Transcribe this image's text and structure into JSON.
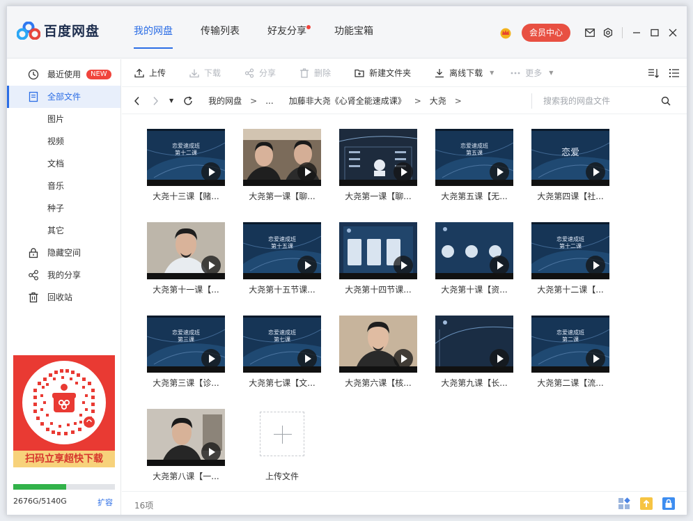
{
  "app": {
    "name": "百度网盘"
  },
  "nav": {
    "tabs": [
      "我的网盘",
      "传输列表",
      "好友分享",
      "功能宝箱"
    ]
  },
  "header": {
    "vip_label": "会员中心"
  },
  "sidebar": {
    "items": [
      {
        "label": "最近使用",
        "badge": "NEW"
      },
      {
        "label": "全部文件"
      },
      {
        "label": "图片"
      },
      {
        "label": "视频"
      },
      {
        "label": "文档"
      },
      {
        "label": "音乐"
      },
      {
        "label": "种子"
      },
      {
        "label": "其它"
      },
      {
        "label": "隐藏空间"
      },
      {
        "label": "我的分享"
      },
      {
        "label": "回收站"
      }
    ],
    "promo_text": "扫码立享超快下载",
    "quota": {
      "text": "2676G/5140G",
      "used_fraction": 0.52,
      "expand_label": "扩容"
    }
  },
  "toolbar": {
    "upload": "上传",
    "download": "下载",
    "share": "分享",
    "delete": "删除",
    "new_folder": "新建文件夹",
    "offline": "离线下载",
    "more": "更多"
  },
  "breadcrumb": {
    "items": [
      "我的网盘",
      "...",
      "加藤非大尧《心肾全能速成课》",
      "大尧"
    ],
    "search_placeholder": "搜索我的网盘文件"
  },
  "files": [
    {
      "name": "大尧十三课【赌...",
      "kind": "slide",
      "slide_text": "恋爱速成班\n第十二课"
    },
    {
      "name": "大尧第一课【聊...",
      "kind": "person2"
    },
    {
      "name": "大尧第一课【聊...",
      "kind": "diagram"
    },
    {
      "name": "大尧第五课【无...",
      "kind": "slide",
      "slide_text": "恋爱速成班\n第五课"
    },
    {
      "name": "大尧第四课【社...",
      "kind": "slide",
      "slide_text": "恋爱"
    },
    {
      "name": "大尧第十一课【...",
      "kind": "person"
    },
    {
      "name": "大尧第十五节课...",
      "kind": "slide",
      "slide_text": "恋爱速成班\n第十五课"
    },
    {
      "name": "大尧第十四节课...",
      "kind": "cards"
    },
    {
      "name": "大尧第十课【资...",
      "kind": "circles"
    },
    {
      "name": "大尧第十二课【...",
      "kind": "slide",
      "slide_text": "恋爱速成班\n第十二课"
    },
    {
      "name": "大尧第三课【诊...",
      "kind": "slide",
      "slide_text": "恋爱速成班\n第三课"
    },
    {
      "name": "大尧第七课【文...",
      "kind": "slide",
      "slide_text": "恋爱速成班\n第七课"
    },
    {
      "name": "大尧第六课【核...",
      "kind": "person_wide"
    },
    {
      "name": "大尧第九课【长...",
      "kind": "dark"
    },
    {
      "name": "大尧第二课【流...",
      "kind": "slide",
      "slide_text": "恋爱速成班\n第二课"
    },
    {
      "name": "大尧第八课【一...",
      "kind": "person_room"
    }
  ],
  "upload_tile_label": "上传文件",
  "footer": {
    "count": "16项"
  },
  "colors": {
    "accent": "#2b6de5",
    "vip": "#e85042",
    "promo": "#e93a33",
    "quota": "#32b24a"
  }
}
